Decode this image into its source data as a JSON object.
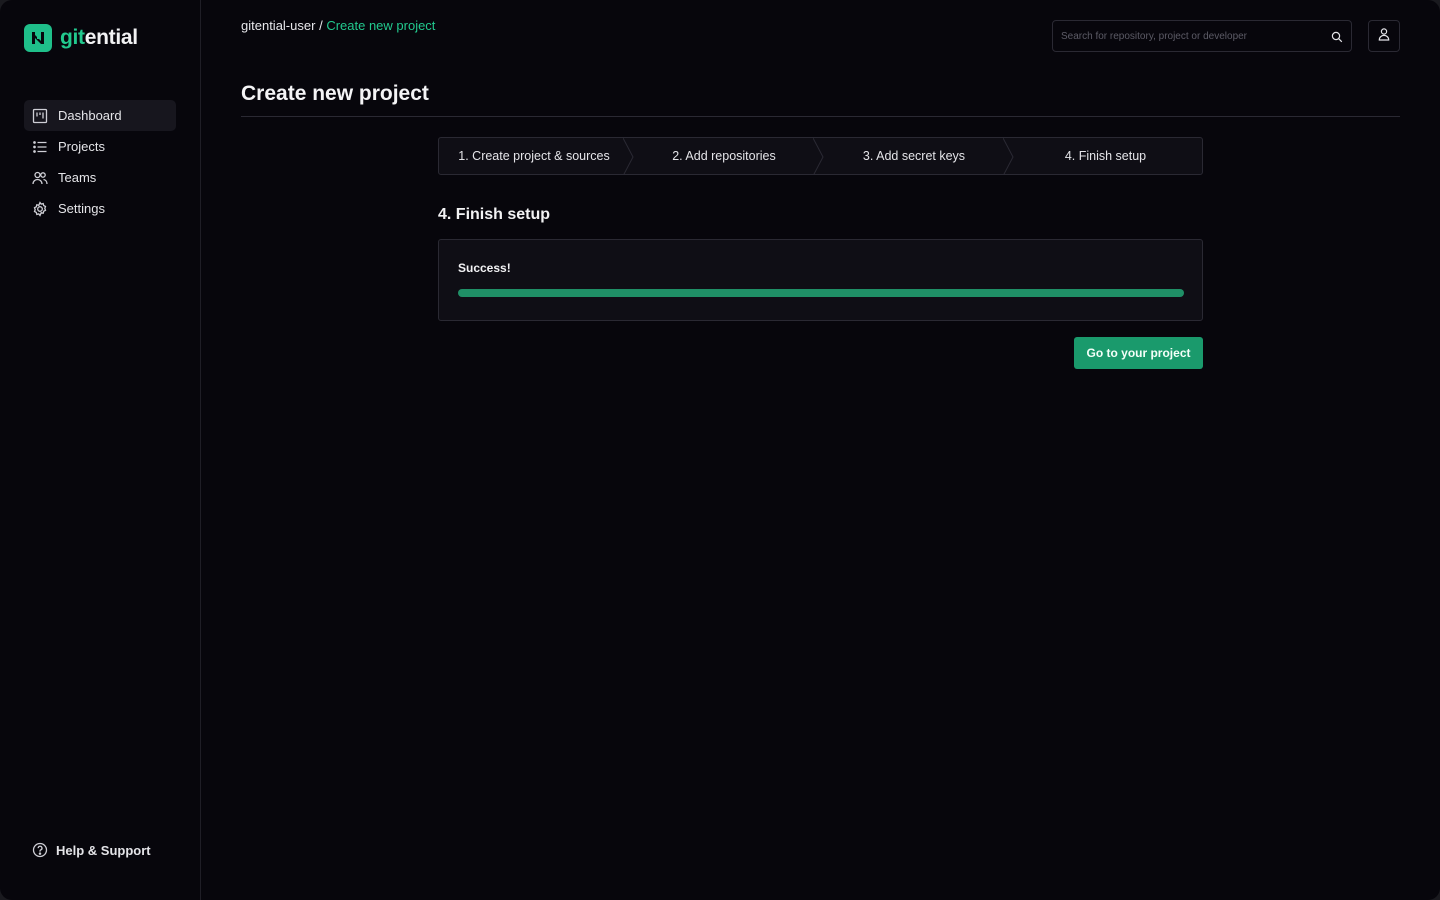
{
  "brand": {
    "name_prefix": "git",
    "name_suffix": "ential",
    "accent": "#22c98e"
  },
  "sidebar": {
    "items": [
      {
        "label": "Dashboard",
        "icon": "dashboard-icon",
        "active": true
      },
      {
        "label": "Projects",
        "icon": "list-icon",
        "active": false
      },
      {
        "label": "Teams",
        "icon": "users-icon",
        "active": false
      },
      {
        "label": "Settings",
        "icon": "gear-icon",
        "active": false
      }
    ],
    "help_label": "Help & Support"
  },
  "header": {
    "breadcrumb_root": "gitential-user",
    "breadcrumb_sep": "/",
    "breadcrumb_current": "Create new project",
    "search_placeholder": "Search for repository, project or developer"
  },
  "page": {
    "title": "Create new project"
  },
  "stepper": {
    "steps": [
      {
        "label": "1. Create project & sources"
      },
      {
        "label": "2. Add repositories"
      },
      {
        "label": "3. Add secret keys"
      },
      {
        "label": "4. Finish setup"
      }
    ]
  },
  "finish": {
    "title": "4. Finish setup",
    "status": "Success!",
    "progress": 1.0,
    "progress_color": "#1f8f66",
    "cta_label": "Go to your project"
  }
}
